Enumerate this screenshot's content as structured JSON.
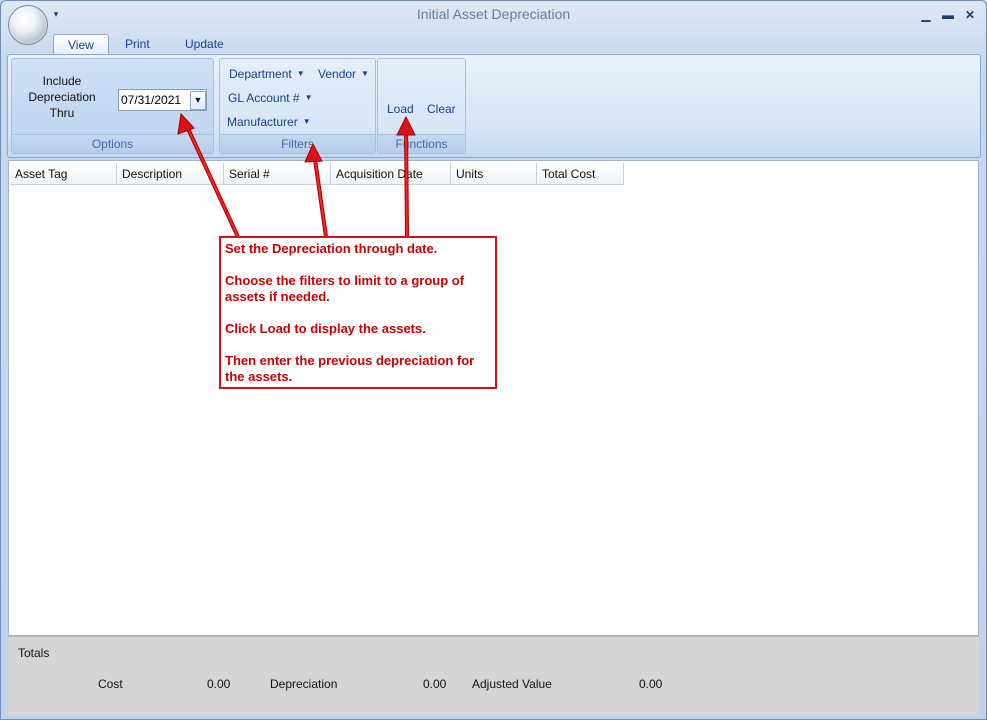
{
  "window": {
    "title": "Initial Asset Depreciation"
  },
  "tabs": [
    {
      "label": "View"
    },
    {
      "label": "Print"
    },
    {
      "label": "Update"
    }
  ],
  "ribbon": {
    "options": {
      "include_label": "Include\nDepreciation\nThru",
      "date_value": "07/31/2021",
      "group_label": "Options"
    },
    "filters": {
      "department": "Department",
      "vendor": "Vendor",
      "gl_account": "GL Account #",
      "manufacturer": "Manufacturer",
      "group_label": "Filters"
    },
    "functions": {
      "load": "Load",
      "clear": "Clear",
      "group_label": "Functions"
    }
  },
  "grid": {
    "columns": [
      "Asset Tag",
      "Description",
      "Serial #",
      "Acquisition Date",
      "Units",
      "Total Cost"
    ]
  },
  "totals": {
    "label": "Totals",
    "cost_label": "Cost",
    "cost_value": "0.00",
    "depreciation_label": "Depreciation",
    "depreciation_value": "0.00",
    "adjusted_label": "Adjusted Value",
    "adjusted_value": "0.00"
  },
  "annotation": {
    "lines": [
      "Set the Depreciation through date.",
      "Choose the filters to limit to a group of assets if needed.",
      "Click Load to display the assets.",
      "Then enter the previous depreciation for the assets."
    ],
    "color": "#cc0000"
  },
  "colors": {
    "ribbon_text": "#15428b",
    "annotation_red": "#cc0000"
  }
}
